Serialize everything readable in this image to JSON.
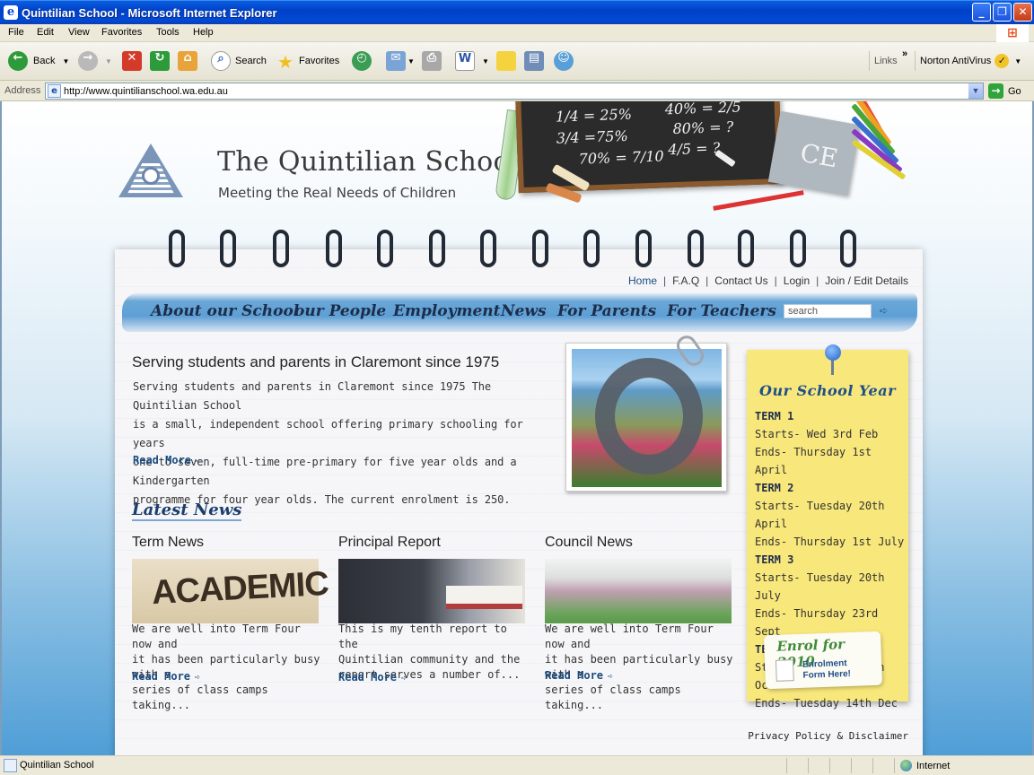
{
  "window": {
    "title": "Quintilian School - Microsoft Internet Explorer",
    "ie_icon": "ie-logo-icon"
  },
  "menu": [
    "File",
    "Edit",
    "View",
    "Favorites",
    "Tools",
    "Help"
  ],
  "toolbar": {
    "back": "Back",
    "search": "Search",
    "favorites": "Favorites",
    "links": "Links",
    "norton": "Norton AntiVirus"
  },
  "address": {
    "label": "Address",
    "url": "http://www.quintilianschool.wa.edu.au",
    "go": "Go"
  },
  "site": {
    "brand": "The Quintilian School",
    "tagline": "Meeting the Real Needs of Children",
    "chalkboard": [
      "1/4 = 25%",
      "40% = 2/5",
      "3/4 =75%",
      "80% = ?",
      "70% = 7/10",
      "4/5 = ?"
    ],
    "book_text": "CE",
    "toplinks": [
      "Home",
      "F.A.Q",
      "Contact Us",
      "Login",
      "Join / Edit Details"
    ],
    "nav": [
      "About our School",
      "our People",
      "Employment",
      "News",
      "For Parents",
      "For Teachers"
    ],
    "search_placeholder": "search",
    "heading": "Serving students and parents in Claremont since 1975",
    "intro": [
      "Serving students and parents in Claremont since 1975 The Quintilian School",
      "is a small, independent school offering primary schooling for years",
      "one to seven, full-time pre-primary for five year olds and a Kindergarten",
      "programme for four year olds. The current enrolment is 250."
    ],
    "read_more": "Read More",
    "latest_news": "Latest News",
    "news": [
      {
        "title": "Term News",
        "image_text": "ACADEMIC",
        "body": [
          "We are well into Term Four now and",
          "it has been particularly busy with a",
          "series of class camps taking..."
        ]
      },
      {
        "title": "Principal Report",
        "body": [
          "This is my tenth report to the",
          "Quintilian community and the",
          "report serves a number of..."
        ]
      },
      {
        "title": "Council News",
        "body": [
          "We are well into Term Four now and",
          "it has been particularly busy with a",
          "series of class camps taking..."
        ]
      }
    ],
    "school_year_title": "Our School Year",
    "terms": [
      {
        "name": "TERM 1",
        "starts": "Starts- Wed 3rd Feb",
        "ends": "Ends-  Thursday 1st April"
      },
      {
        "name": "TERM 2",
        "starts": "Starts- Tuesday 20th April",
        "ends": "Ends-  Thursday 1st July"
      },
      {
        "name": "TERM 3",
        "starts": "Starts- Tuesday 20th July",
        "ends": "Ends-  Thursday 23rd Sept"
      },
      {
        "name": "TERM 4",
        "starts": "Starts- Tuesday 12th Oct",
        "ends": "Ends-  Tuesday 14th Dec"
      }
    ],
    "enrol_title": "Enrol for 2010",
    "enrol_form_1": "Enrolment",
    "enrol_form_2": "Form Here!",
    "privacy": "Privacy Policy & Disclaimer"
  },
  "status": {
    "text": "Quintilian School",
    "zone": "Internet"
  }
}
